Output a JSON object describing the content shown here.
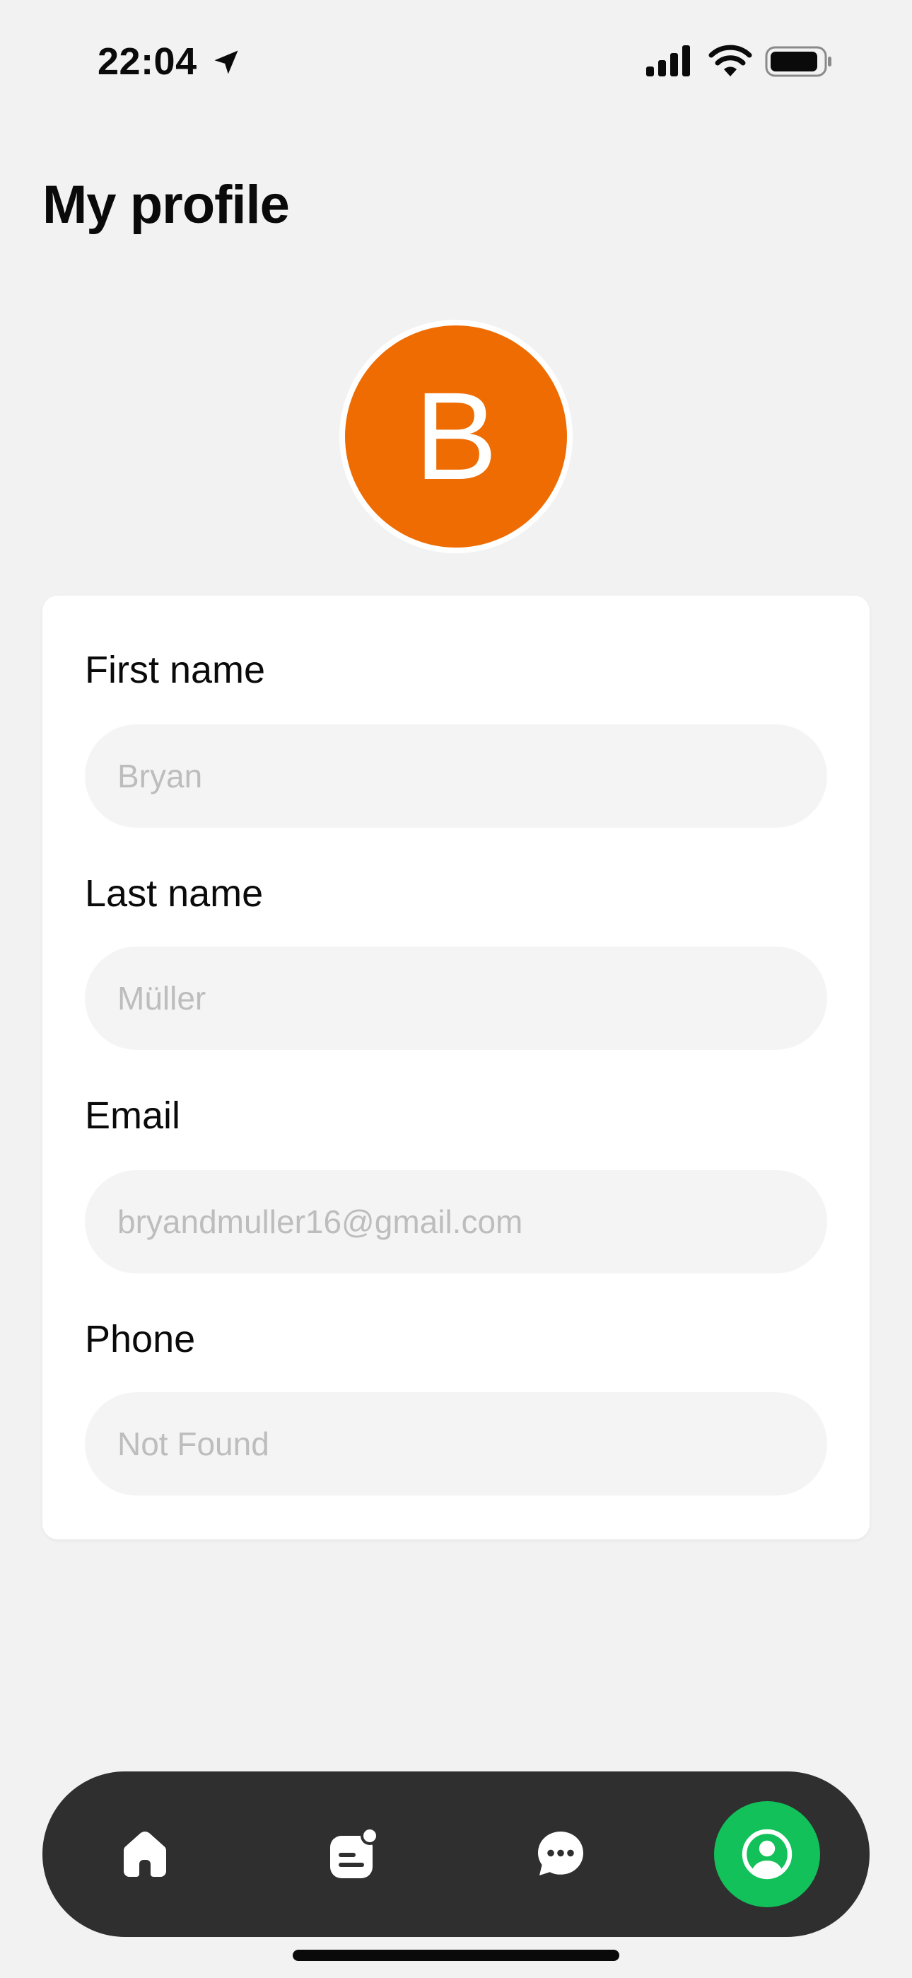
{
  "status_bar": {
    "time": "22:04"
  },
  "page": {
    "title": "My profile"
  },
  "avatar": {
    "initial": "B",
    "background_color": "#ee6c02"
  },
  "form": {
    "fields": [
      {
        "label": "First name",
        "value": "",
        "placeholder": "Bryan"
      },
      {
        "label": "Last name",
        "value": "",
        "placeholder": "Müller"
      },
      {
        "label": "Email",
        "value": "",
        "placeholder": "bryandmuller16@gmail.com"
      },
      {
        "label": "Phone",
        "value": "",
        "placeholder": "Not Found"
      }
    ]
  },
  "bottom_nav": {
    "items": [
      {
        "icon": "home-icon",
        "active": false
      },
      {
        "icon": "document-icon",
        "active": false
      },
      {
        "icon": "chat-icon",
        "active": false
      },
      {
        "icon": "profile-icon",
        "active": true
      }
    ],
    "background_color": "#2f2f2f",
    "active_color": "#12c15a"
  },
  "colors": {
    "page_background": "#f2f2f2",
    "card_background": "#ffffff",
    "input_background": "#f4f4f4",
    "placeholder_text": "#bdbdbd"
  }
}
